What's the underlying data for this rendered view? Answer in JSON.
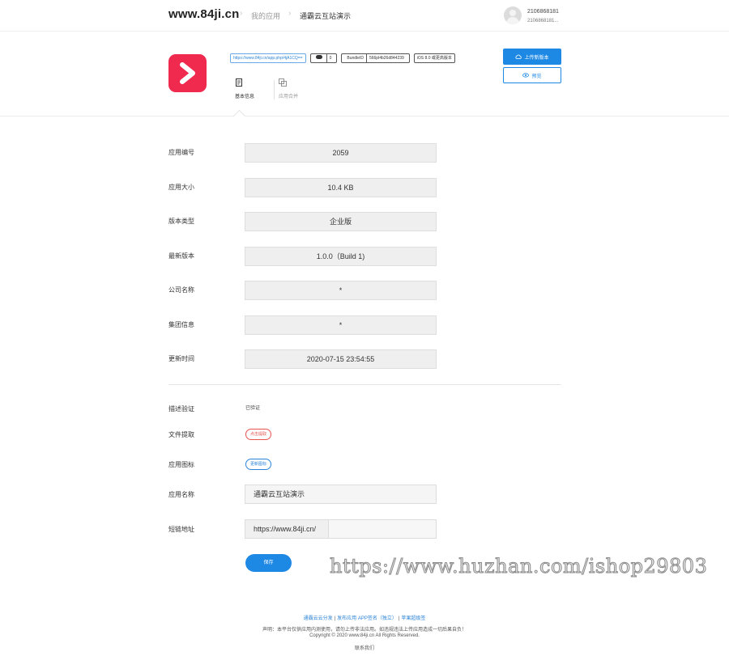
{
  "header": {
    "site": "www.84ji.cn",
    "breadcrumb": [
      "我的应用",
      "通霸云互站演示"
    ],
    "user_line1": "2106868181",
    "user_line2": "2106868181..."
  },
  "app": {
    "tags": {
      "link": "https://www.84ji.cn/app.php/4jA1CQ==",
      "count": "0",
      "bundle_label": "BundleID",
      "bundle_value": "566pl4b26d844239",
      "ios": "iOS 8.0 或更高版本"
    },
    "tabs": [
      "基本信息",
      "应用合并"
    ],
    "upload_label": "上传新版本",
    "preview_label": "预览",
    "brand_color": "#f0294f",
    "accent_color": "#1e88e5"
  },
  "info": {
    "rows": [
      {
        "label": "应用编号",
        "value": "2059"
      },
      {
        "label": "应用大小",
        "value": "10.4 KB"
      },
      {
        "label": "版本类型",
        "value": "企业版"
      },
      {
        "label": "最新版本",
        "value": "1.0.0（Build 1)"
      },
      {
        "label": "公司名称",
        "value": "*"
      },
      {
        "label": "集团信息",
        "value": "*"
      },
      {
        "label": "更新时间",
        "value": "2020-07-15 23:54:55"
      }
    ]
  },
  "edit": {
    "desc_label": "描述验证",
    "desc_value": "已验证",
    "file_label": "文件提取",
    "file_btn": "点击提取",
    "icon_label": "应用图标",
    "icon_btn": "更新图标",
    "name_label": "应用名称",
    "name_value": "通霸云互站演示",
    "short_label": "短链地址",
    "short_prefix": "https://www.84ji.cn/",
    "short_value": "",
    "save_label": "保存"
  },
  "watermark": "https://www.huzhan.com/ishop29803",
  "footer": {
    "links": [
      "通霸云云分发",
      "发布应用 APP签名（独立）",
      "苹果超级签"
    ],
    "notice": "声明：本平台仅供应用内测使用，请勿上传非法应用。如违规违法上传应用造成一切后果自负！",
    "copyright": "Copyright © 2020 www.84ji.cn  All Rights Reserved.",
    "contact": "联系我们"
  }
}
